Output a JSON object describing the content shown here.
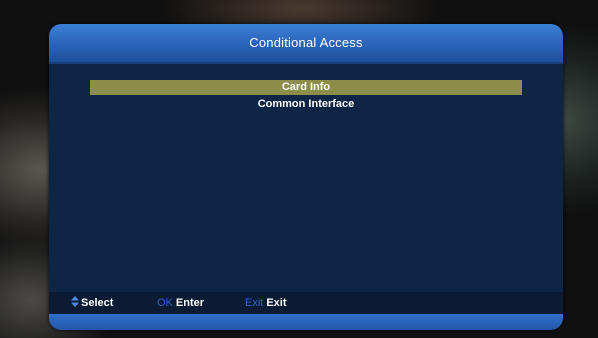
{
  "title": "Conditional Access",
  "menu": {
    "items": [
      {
        "label": "Card Info",
        "selected": true
      },
      {
        "label": "Common Interface",
        "selected": false
      }
    ]
  },
  "footer": {
    "select": {
      "icon": "up-down-arrows-icon",
      "label": "Select"
    },
    "enter": {
      "key": "OK",
      "label": "Enter"
    },
    "exit": {
      "key": "Exit",
      "label": "Exit"
    }
  },
  "colors": {
    "title_bar": "#2a63b8",
    "panel": "#0f2545",
    "highlight": "#8c8e4a",
    "key_text": "#2b62c9"
  }
}
